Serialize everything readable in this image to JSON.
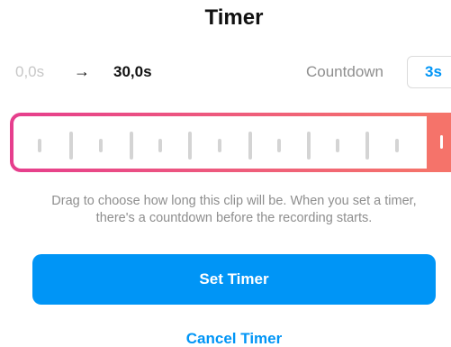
{
  "title": "Timer",
  "range": {
    "start": "0,0s",
    "end": "30,0s"
  },
  "countdown": {
    "label": "Countdown",
    "value": "3s"
  },
  "slider": {
    "selected_fraction": 1.0
  },
  "helper_text": {
    "line1": "Drag to choose how long this clip will be. When you set a timer,",
    "line2": "there's a countdown before the recording starts."
  },
  "buttons": {
    "set_timer": "Set Timer",
    "cancel_timer": "Cancel Timer"
  },
  "colors": {
    "accent_blue": "#0095f6",
    "slider_gradient_start": "#e63e8d",
    "slider_gradient_end": "#f5736a",
    "muted_text": "#8e8e8e"
  },
  "icons": {
    "range_arrow": "arrow-right-icon"
  }
}
